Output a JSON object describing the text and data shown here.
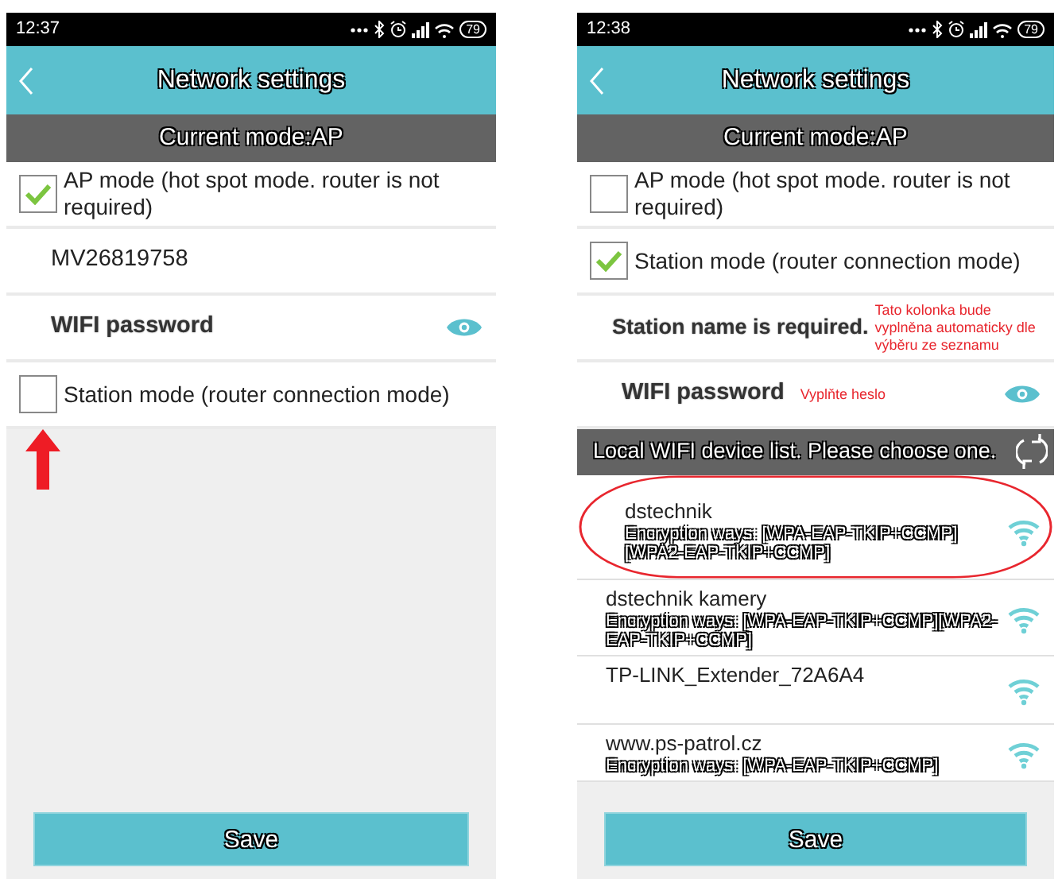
{
  "screens": [
    {
      "status_bar": {
        "time": "12:37",
        "battery": "79"
      },
      "header": {
        "title": "Network settings"
      },
      "mode_bar": "Current mode:AP",
      "rows": [
        {
          "kind": "checkbox",
          "label": "AP mode (hot spot mode. router is not required)",
          "checked": true
        },
        {
          "kind": "field",
          "value": "MV26819758"
        },
        {
          "kind": "password",
          "placeholder": "WIFI password"
        },
        {
          "kind": "checkbox",
          "label": "Station mode (router connection mode)",
          "checked": false,
          "arrow": true
        }
      ],
      "save_button": "Save"
    },
    {
      "status_bar": {
        "time": "12:38",
        "battery": "79"
      },
      "header": {
        "title": "Network settings"
      },
      "mode_bar": "Current mode:AP",
      "rows": [
        {
          "kind": "checkbox",
          "label": "AP mode (hot spot mode. router is not required)",
          "checked": false
        },
        {
          "kind": "checkbox",
          "label": "Station mode (router connection mode)",
          "checked": true
        },
        {
          "kind": "field",
          "placeholder": "Station name is required.",
          "note": "Tato kolonka bude vyplněna automaticky dle výběru ze seznamu"
        },
        {
          "kind": "password",
          "placeholder": "WIFI password",
          "note": "Vyplňte heslo"
        }
      ],
      "device_list": {
        "title": "Local WIFI device list. Please choose one.",
        "items": [
          {
            "name": "dstechnik",
            "encryption": "Encryption ways: [WPA-EAP-TKIP+CCMP][WPA2-EAP-TKIP+CCMP]",
            "circled": true
          },
          {
            "name": "dstechnik kamery",
            "encryption": "Encryption ways: [WPA-EAP-TKIP+CCMP][WPA2-EAP-TKIP+CCMP]",
            "circled": false
          },
          {
            "name": "TP-LINK_Extender_72A6A4",
            "circled": false
          },
          {
            "name": "www.ps-patrol.cz",
            "encryption": "Encryption ways: [WPA-EAP-TKIP+CCMP]",
            "circled": false
          }
        ]
      },
      "save_button": "Save"
    }
  ]
}
